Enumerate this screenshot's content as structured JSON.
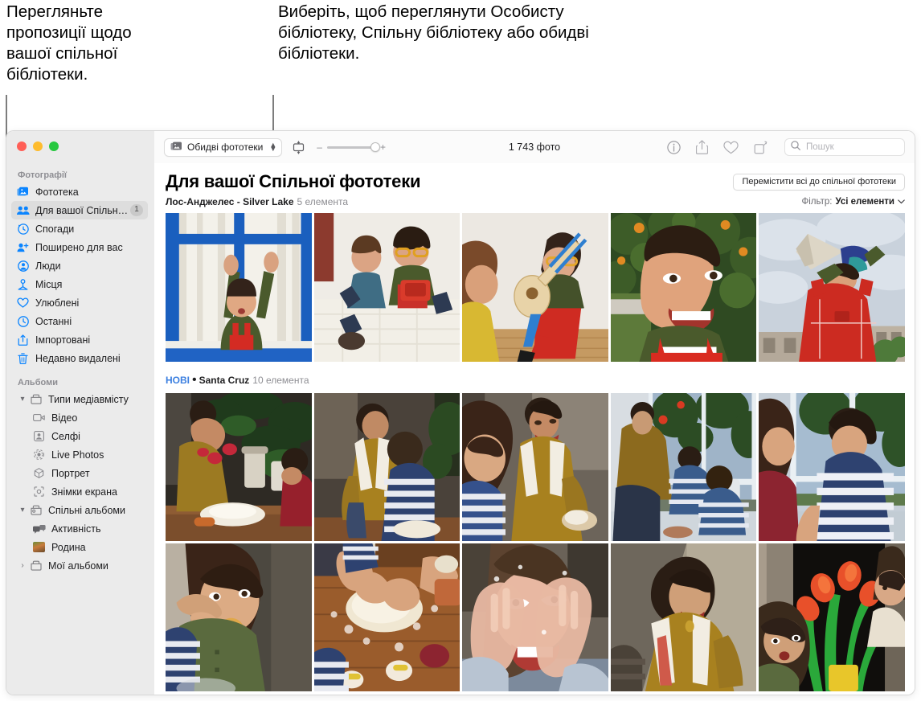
{
  "callouts": [
    {
      "id": "c1",
      "text": "Перегляньте пропозиції щодо вашої спільної бібліотеки."
    },
    {
      "id": "c2",
      "text": "Виберіть, щоб переглянути Особисту бібліотеку, Спільну бібліотеку або обидві бібліотеки."
    }
  ],
  "window": {
    "traffic_lights": [
      "close",
      "minimize",
      "zoom"
    ]
  },
  "sidebar": {
    "sections": [
      {
        "label": "Фотографії",
        "items": [
          {
            "label": "Фототека",
            "icon": "photo-library-icon",
            "selected": false,
            "badge": ""
          },
          {
            "label": "Для вашої Спільної фо...",
            "icon": "two-people-icon",
            "selected": true,
            "badge": "1"
          },
          {
            "label": "Спогади",
            "icon": "memories-icon",
            "selected": false,
            "badge": ""
          },
          {
            "label": "Поширено для вас",
            "icon": "shared-with-you-icon",
            "selected": false,
            "badge": ""
          },
          {
            "label": "Люди",
            "icon": "person-icon",
            "selected": false,
            "badge": ""
          },
          {
            "label": "Місця",
            "icon": "places-pin-icon",
            "selected": false,
            "badge": ""
          },
          {
            "label": "Улюблені",
            "icon": "heart-icon",
            "selected": false,
            "badge": ""
          },
          {
            "label": "Останні",
            "icon": "clock-icon",
            "selected": false,
            "badge": ""
          },
          {
            "label": "Імпортовані",
            "icon": "import-icon",
            "selected": false,
            "badge": ""
          },
          {
            "label": "Недавно видалені",
            "icon": "trash-icon",
            "selected": false,
            "badge": ""
          }
        ]
      },
      {
        "label": "Альбоми",
        "groups": [
          {
            "label": "Типи медіавмісту",
            "icon": "folder-icon",
            "expanded": true,
            "disclosure": "▾",
            "children": [
              {
                "label": "Відео",
                "icon": "video-icon"
              },
              {
                "label": "Селфі",
                "icon": "selfie-icon"
              },
              {
                "label": "Live Photos",
                "icon": "live-photo-icon"
              },
              {
                "label": "Портрет",
                "icon": "portrait-icon"
              },
              {
                "label": "Знімки екрана",
                "icon": "screenshot-icon"
              }
            ]
          },
          {
            "label": "Спільні альбоми",
            "icon": "shared-folder-icon",
            "expanded": true,
            "disclosure": "▾",
            "children": [
              {
                "label": "Активність",
                "icon": "activity-icon"
              },
              {
                "label": "Родина",
                "icon": "album-thumbnail-icon"
              }
            ]
          },
          {
            "label": "Мої альбоми",
            "icon": "folder-icon",
            "expanded": false,
            "disclosure": "›",
            "children": []
          }
        ]
      }
    ]
  },
  "toolbar": {
    "library_popup": {
      "label": "Обидві фототеки",
      "icon": "library-picker-icon",
      "stepper": "chevron-updown-icon"
    },
    "view_mode_icon": "aspect-fill-icon",
    "zoom": {
      "minus": "–",
      "plus": "+",
      "value": 85
    },
    "photo_count": "1 743 фото",
    "actions": [
      {
        "icon": "info-icon",
        "name": "info-button"
      },
      {
        "icon": "share-icon",
        "name": "share-button"
      },
      {
        "icon": "heart-icon",
        "name": "favorite-button"
      },
      {
        "icon": "rotate-icon",
        "name": "rotate-button"
      }
    ],
    "search": {
      "placeholder": "Пошук",
      "value": "",
      "icon": "search-icon"
    }
  },
  "content": {
    "title": "Для вашої Спільної фототеки",
    "move_all_button": "Перемістити всі до спільної фототеки",
    "filter": {
      "label": "Фільтр:",
      "value": "Усі елементи",
      "chevron": "chevron-down-icon"
    },
    "sections": [
      {
        "new_tag": "",
        "title": "Лос-Анджелес - Silver Lake",
        "count": "5 елемента",
        "photos": [
          {
            "alt": "Дитина піднімає руки біля синього вікна"
          },
          {
            "alt": "Двоє дітей на ліжку з червоною коробкою"
          },
          {
            "alt": "Дитина грає на іграшковій гітарі"
          },
          {
            "alt": "Дитина посміхається під апельсиновим деревом"
          },
          {
            "alt": "Дитина з мегафоном на тлі неба"
          }
        ]
      },
      {
        "new_tag": "НОВІ",
        "separator": "•",
        "title": "Santa Cruz",
        "count": "10 елемента",
        "photos": [
          {
            "alt": "Жінка і діти готують на кухні з рослинами"
          },
          {
            "alt": "Жінка допомагає дитині місити тісто"
          },
          {
            "alt": "Жінка посміхається, дитина на передньому плані"
          },
          {
            "alt": "Діти біля великого вікна в сад"
          },
          {
            "alt": "Двоє дітей біля скляних дверей"
          },
          {
            "alt": "Дитина їсть біля раковини"
          },
          {
            "alt": "Руки розкочують тісто на дерев'яному столі"
          },
          {
            "alt": "Дитина закриває обличчя борошняними руками"
          },
          {
            "alt": "Жінка з рушником посміхається"
          },
          {
            "alt": "Дитина дивиться на червоні тюльпани"
          }
        ]
      }
    ]
  }
}
